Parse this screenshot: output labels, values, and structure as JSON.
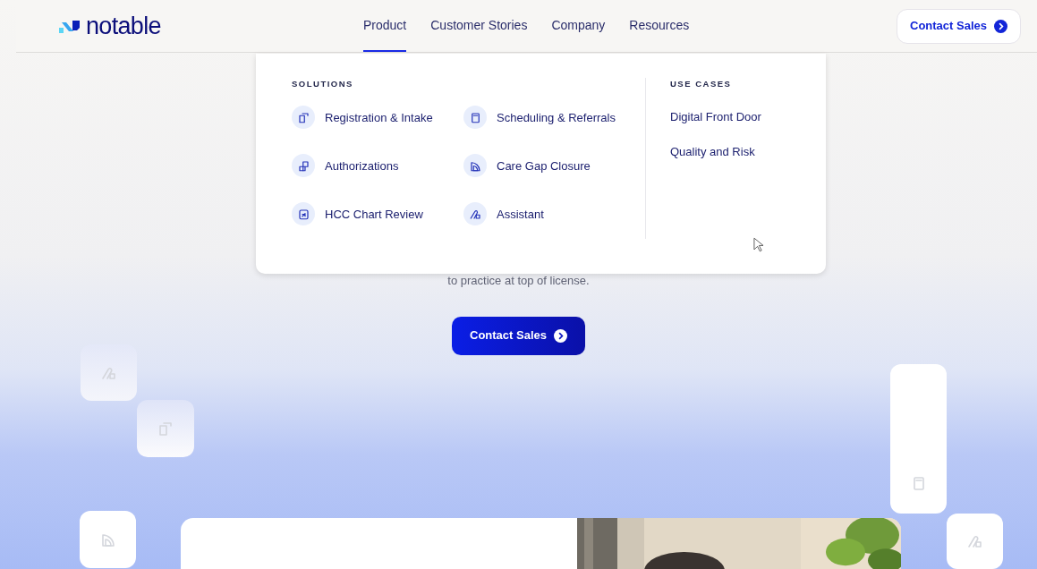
{
  "header": {
    "logo": "notable",
    "nav": [
      {
        "label": "Product",
        "selected": true
      },
      {
        "label": "Customer Stories",
        "selected": false
      },
      {
        "label": "Company",
        "selected": false
      },
      {
        "label": "Resources",
        "selected": false
      }
    ],
    "cta": "Contact Sales"
  },
  "menu": {
    "solutions": {
      "heading": "SOLUTIONS",
      "items": [
        {
          "label": "Registration & Intake",
          "kind": "registration"
        },
        {
          "label": "Scheduling & Referrals",
          "kind": "clipboard"
        },
        {
          "label": "Authorizations",
          "kind": "authorization"
        },
        {
          "label": "Care Gap Closure",
          "kind": "quarter"
        },
        {
          "label": "HCC Chart Review",
          "kind": "review"
        },
        {
          "label": "Assistant",
          "kind": "assistant"
        }
      ]
    },
    "use_cases": {
      "heading": "USE CASES",
      "items": [
        "Digital Front Door",
        "Quality and Risk"
      ]
    }
  },
  "hero": {
    "text": "to practice at top of license.",
    "button": "Contact Sales"
  },
  "tiles": [
    {
      "kind": "assistant"
    },
    {
      "kind": "registration"
    },
    {
      "kind": "quarter"
    },
    {
      "kind": "clipboard"
    },
    {
      "kind": "assistant"
    }
  ]
}
